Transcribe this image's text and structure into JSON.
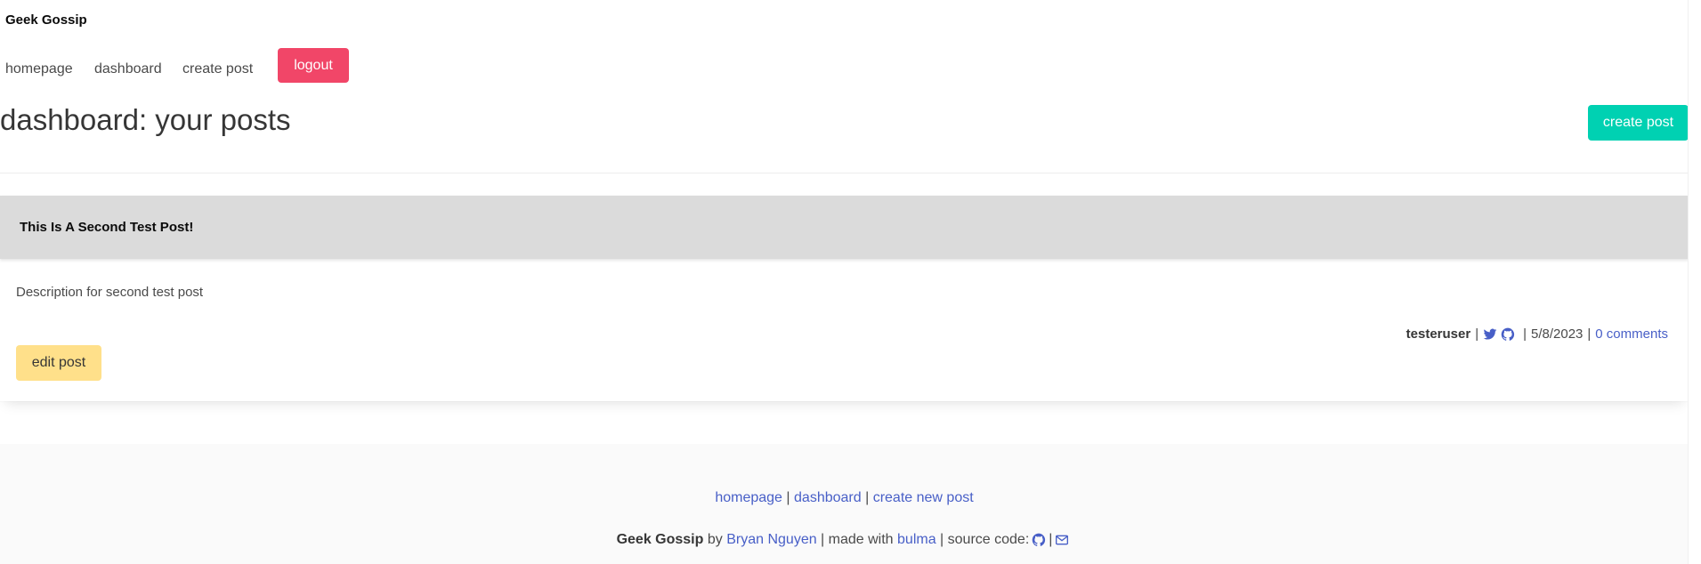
{
  "navbar": {
    "brand": "Geek Gossip",
    "links": [
      "homepage",
      "dashboard",
      "create post"
    ],
    "logout_label": "logout"
  },
  "page": {
    "title": "dashboard: your posts",
    "create_post_label": "create post"
  },
  "post": {
    "title": "This Is A Second Test Post!",
    "description": "Description for second test post",
    "author": "testeruser",
    "date": "5/8/2023",
    "comments": "0 comments",
    "edit_label": "edit post",
    "icons": [
      "twitter-icon",
      "github-icon"
    ]
  },
  "footer": {
    "links": [
      "homepage",
      "dashboard",
      "create new post"
    ],
    "brand": "Geek Gossip",
    "by_text": "by",
    "author_link": "Bryan Nguyen",
    "made_with_text": "made with",
    "bulma_link": "bulma",
    "source_code_text": "source code:",
    "icons": [
      "github-icon",
      "envelope-icon"
    ]
  },
  "colors": {
    "logout": "#f14668",
    "primary": "#00d1b2",
    "warning": "#ffe08a",
    "link": "#485fc7",
    "card_header": "#dbdbdb",
    "footer_bg": "#fafafa"
  }
}
